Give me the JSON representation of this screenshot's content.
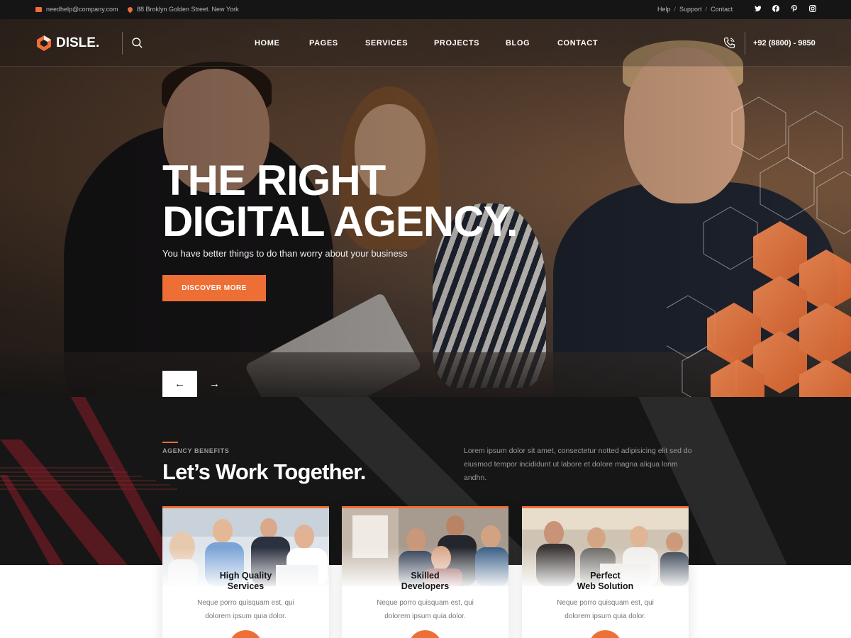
{
  "topbar": {
    "email": "needhelp@company.com",
    "address": "88 Broklyn Golden Street. New York",
    "links": [
      "Help",
      "Support",
      "Contact"
    ],
    "social": [
      "twitter-icon",
      "facebook-icon",
      "pinterest-icon",
      "instagram-icon"
    ]
  },
  "nav": {
    "logo": "DISLE.",
    "items": [
      "HOME",
      "PAGES",
      "SERVICES",
      "PROJECTS",
      "BLOG",
      "CONTACT"
    ],
    "phone": "+92 (8800) - 9850"
  },
  "hero": {
    "title_line1": "THE RIGHT",
    "title_line2": "DIGITAL AGENCY.",
    "subtitle": "You have better things to do than worry about your business",
    "button": "DISCOVER MORE",
    "prev": "←",
    "next": "→"
  },
  "benefits": {
    "eyebrow": "AGENCY BENEFITS",
    "title": "Let’s Work Together.",
    "description": "Lorem ipsum dolor sit amet, consectetur notted adipisicing elit sed do eiusmod tempor incididunt ut labore et dolore magna aliqua lonm andhn.",
    "cards": [
      {
        "title1": "High Quality",
        "title2": "Services",
        "text1": "Neque porro quisquam est, qui",
        "text2": "dolorem ipsum quia dolor."
      },
      {
        "title1": "Skilled",
        "title2": "Developers",
        "text1": "Neque porro quisquam est, qui",
        "text2": "dolorem ipsum quia dolor."
      },
      {
        "title1": "Perfect",
        "title2": "Web Solution",
        "text1": "Neque porro quisquam est, qui",
        "text2": "dolorem ipsum quia dolor."
      }
    ]
  },
  "colors": {
    "accent": "#ee6f36",
    "dark": "#161616"
  }
}
